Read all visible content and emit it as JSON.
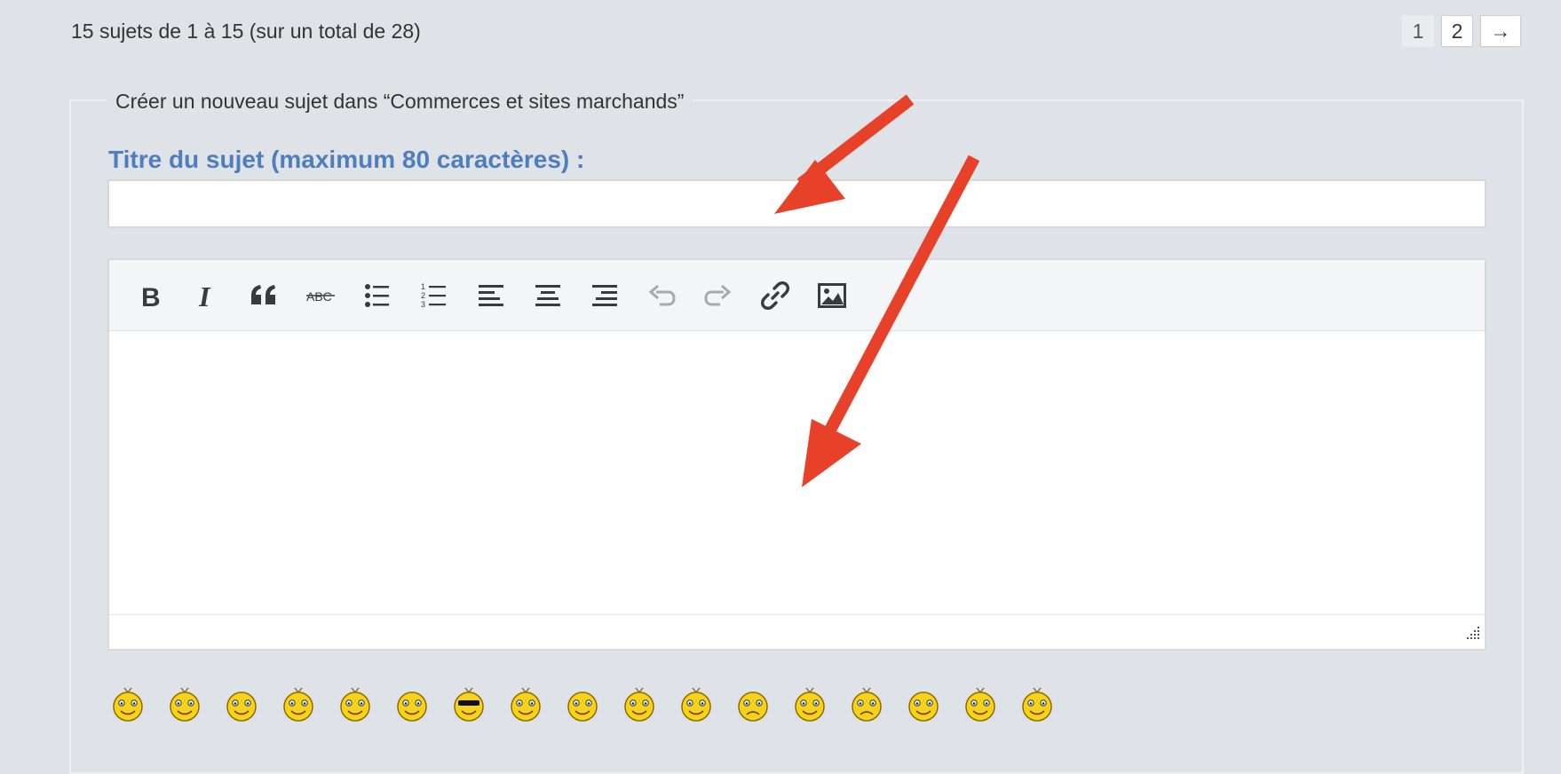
{
  "header": {
    "topic_count": "15 sujets de 1 à 15 (sur un total de 28)",
    "pagination": {
      "pages": [
        "1",
        "2"
      ],
      "current": "1",
      "next_label": "→"
    }
  },
  "form": {
    "legend": "Créer un nouveau sujet dans “Commerces et sites marchands”",
    "subject_label": "Titre du sujet (maximum 80 caractères) :",
    "subject_value": ""
  },
  "editor": {
    "toolbar": [
      {
        "name": "bold",
        "icon": "bold-icon"
      },
      {
        "name": "italic",
        "icon": "italic-icon"
      },
      {
        "name": "blockquote",
        "icon": "quote-icon"
      },
      {
        "name": "strikethrough",
        "icon": "strikethrough-icon",
        "text": "ABC"
      },
      {
        "name": "bullet-list",
        "icon": "bullet-list-icon"
      },
      {
        "name": "numbered-list",
        "icon": "numbered-list-icon",
        "text": "1 2 3"
      },
      {
        "name": "align-left",
        "icon": "align-left-icon"
      },
      {
        "name": "align-center",
        "icon": "align-center-icon"
      },
      {
        "name": "align-right",
        "icon": "align-right-icon"
      },
      {
        "name": "undo",
        "icon": "undo-icon",
        "disabled": true
      },
      {
        "name": "redo",
        "icon": "redo-icon",
        "disabled": true
      },
      {
        "name": "link",
        "icon": "link-icon"
      },
      {
        "name": "image",
        "icon": "image-icon"
      }
    ],
    "body_value": ""
  },
  "smileys": [
    "smiley-wave-icon",
    "smiley-thumbs-up-icon",
    "smiley-wink-icon",
    "smiley-surprised-icon",
    "smiley-hmm-icon",
    "smiley-laugh-icon",
    "smiley-sunglasses-icon",
    "smiley-love-icon",
    "smiley-rose-icon",
    "smiley-whistle-icon",
    "smiley-smile-icon",
    "smiley-sad-icon",
    "smiley-mad-icon",
    "smiley-frown-icon",
    "smiley-shrug-icon",
    "smiley-grin-icon",
    "smiley-neutral-icon"
  ],
  "colors": {
    "background": "#dfe2e6",
    "subject_label": "#4d7fbe",
    "annotation_arrow": "#e8412a"
  }
}
